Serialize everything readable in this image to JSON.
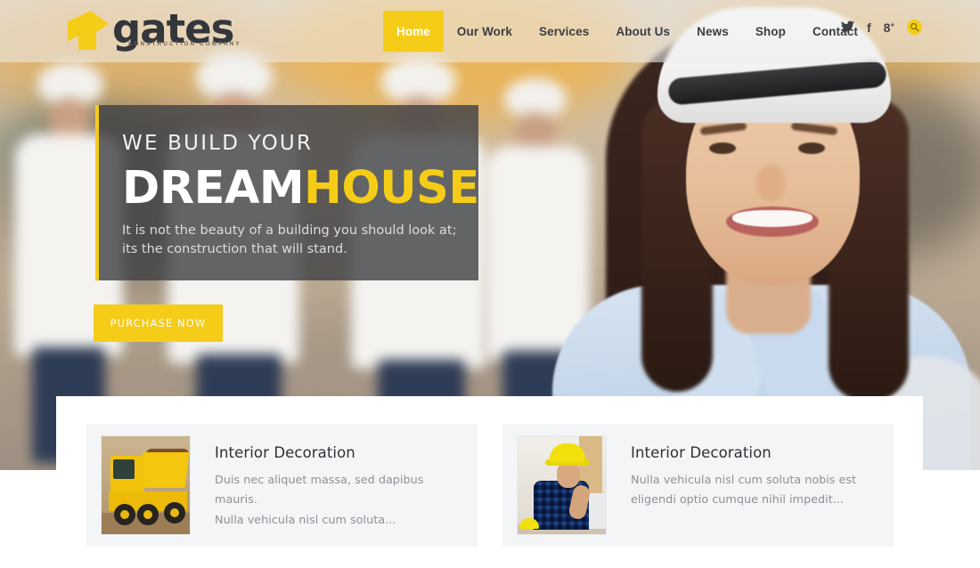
{
  "site": {
    "logo_text": "gates",
    "logo_tagline": "CONSTRUCTION COMPANY",
    "accent_color": "#f5cc18",
    "dark_color": "#3e4044"
  },
  "nav": {
    "items": [
      {
        "label": "Home",
        "active": true
      },
      {
        "label": "Our Work",
        "active": false
      },
      {
        "label": "Services",
        "active": false
      },
      {
        "label": "About Us",
        "active": false
      },
      {
        "label": "News",
        "active": false
      },
      {
        "label": "Shop",
        "active": false
      },
      {
        "label": "Contact",
        "active": false
      }
    ]
  },
  "social": {
    "twitter": "twitter-icon",
    "facebook": "facebook-icon",
    "googleplus": "googleplus-icon",
    "search": "search-icon"
  },
  "hero": {
    "kicker": "WE BUILD YOUR",
    "title_white": "DREAM",
    "title_yellow": "HOUSE",
    "subtitle_line1": "It is not the beauty of a building you should look at;",
    "subtitle_line2": "its the construction that will stand.",
    "cta_label": "PURCHASE NOW"
  },
  "cards": [
    {
      "title": "Interior Decoration",
      "text_line1": "Duis nec aliquet massa, sed dapibus mauris.",
      "text_line2": "Nulla vehicula nisl cum soluta...",
      "thumb": "dump-truck-photo"
    },
    {
      "title": "Interior Decoration",
      "text_line1": "Nulla vehicula nisl cum soluta nobis est",
      "text_line2": "eligendi optio cumque nihil impedit...",
      "thumb": "construction-worker-photo"
    }
  ]
}
